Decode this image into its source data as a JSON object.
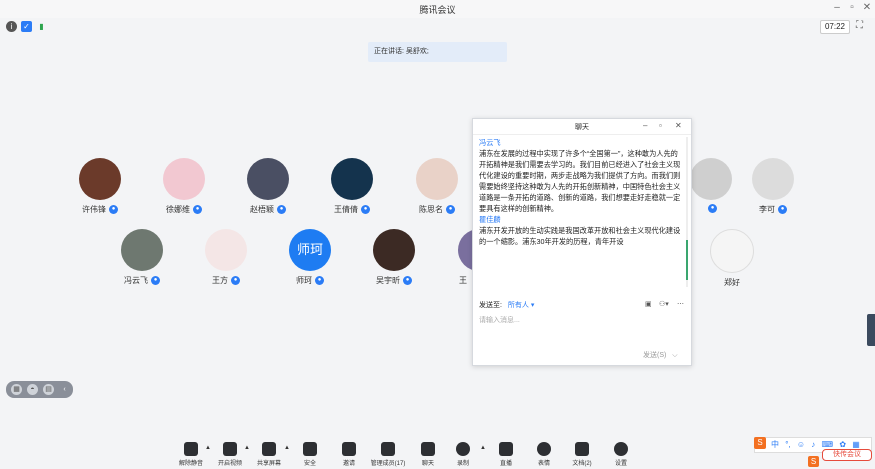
{
  "app": {
    "title": "腾讯会议",
    "time": "07:22"
  },
  "speaking": {
    "text": "正在讲话: 吴舒欢;"
  },
  "participants_row1": [
    {
      "name": "许伟锋",
      "color": "#6b3a2a"
    },
    {
      "name": "徐娜维",
      "color": "#f2c8d1"
    },
    {
      "name": "赵梧颖",
      "color": "#4a4f63"
    },
    {
      "name": "王倩倩",
      "color": "#14334d"
    },
    {
      "name": "陈思名",
      "color": "#e9d2c8"
    },
    {
      "name": "",
      "color": "#cfcfcf"
    },
    {
      "name": "李可",
      "color": "#dcdcdc"
    }
  ],
  "participants_row2": [
    {
      "name": "冯云飞",
      "color": "#6e7870"
    },
    {
      "name": "王方",
      "color": "#f4e6e6"
    },
    {
      "name": "师珂",
      "color": "#1e7cf2",
      "initials": "师珂"
    },
    {
      "name": "吴宇昕",
      "color": "#3c2a24"
    },
    {
      "name": "王",
      "color": "#7a6f9e"
    },
    {
      "name": "郑好",
      "color": "#f5f5f5"
    }
  ],
  "chat": {
    "title": "聊天",
    "messages": [
      {
        "sender": "冯云飞",
        "text": "浦东在发展的过程中实现了许多个“全国第一”，这种敢为人先的开拓精神是我们需要去学习的。我们目前已经进入了社会主义现代化建设的重要时期，两步走战略为我们提供了方向。而我们则需要始终坚持这种敢为人先的开拓创新精神，中国特色社会主义道路是一条开拓的道路、创新的道路，我们想要走好走稳就一定要具有这样的创新精神。"
      },
      {
        "sender": "瞿佳麟",
        "text": "浦东开发开放的生动实践是我国改革开放和社会主义现代化建设的一个缩影。浦东30年开发的历程，青年开设"
      }
    ],
    "send_to_label": "发送至:",
    "send_to_value": "所有人",
    "input_placeholder": "请输入消息...",
    "send_button": "发送(S)"
  },
  "toolbar": {
    "items": [
      {
        "label": "解除静音",
        "icon": "mic-muted-icon"
      },
      {
        "label": "开启视频",
        "icon": "video-off-icon"
      },
      {
        "label": "共享屏幕",
        "icon": "share-screen-icon"
      },
      {
        "label": "安全",
        "icon": "shield-icon"
      },
      {
        "label": "邀请",
        "icon": "invite-icon"
      },
      {
        "label": "管理成员(17)",
        "icon": "members-icon"
      },
      {
        "label": "聊天",
        "icon": "chat-icon"
      },
      {
        "label": "录制",
        "icon": "record-icon"
      },
      {
        "label": "直播",
        "icon": "live-icon"
      },
      {
        "label": "表情",
        "icon": "emoji-icon"
      },
      {
        "label": "文档(2)",
        "icon": "document-icon"
      },
      {
        "label": "设置",
        "icon": "settings-icon"
      }
    ]
  },
  "ime": {
    "text": "中",
    "promo": "快传会议"
  }
}
